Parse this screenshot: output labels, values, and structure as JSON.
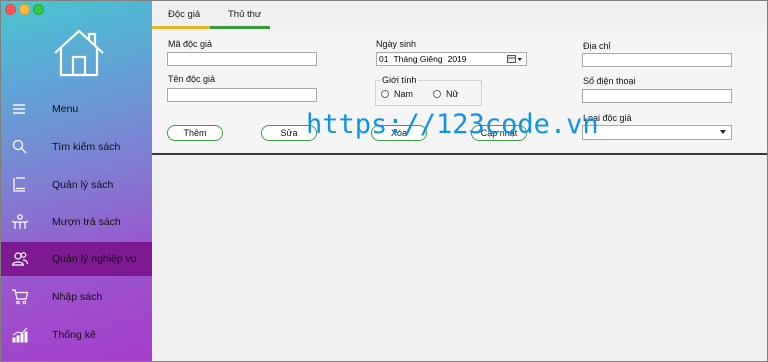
{
  "sidebar": {
    "home_icon": "home-icon",
    "items": [
      {
        "label": "Menu",
        "icon": "hamburger-icon"
      },
      {
        "label": "Tìm kiếm sách",
        "icon": "search-icon"
      },
      {
        "label": "Quản lý sách",
        "icon": "book-icon"
      },
      {
        "label": "Mượn trả sách",
        "icon": "borrow-icon"
      },
      {
        "label": "Quản lý nghiệp vu",
        "icon": "users-icon",
        "active": true
      },
      {
        "label": "Nhập sách",
        "icon": "cart-icon"
      },
      {
        "label": "Thống kê",
        "icon": "chart-icon"
      }
    ],
    "active_color": "#7d1a92"
  },
  "tabs": [
    {
      "label": "Độc giả",
      "underline_color": "#e0b824"
    },
    {
      "label": "Thủ thư",
      "underline_color": "#3a9a3a"
    }
  ],
  "form": {
    "ma_doc_gia": {
      "label": "Mã độc giả",
      "value": ""
    },
    "ten_doc_gia": {
      "label": "Tên độc giả",
      "value": ""
    },
    "ngay_sinh": {
      "label": "Ngày sinh",
      "day": "01",
      "month": "Tháng Giêng",
      "year": "2019"
    },
    "gioi_tinh": {
      "label": "Giới tính",
      "options": [
        "Nam",
        "Nữ"
      ]
    },
    "dia_chi": {
      "label": "Địa chỉ",
      "value": ""
    },
    "so_dien_thoai": {
      "label": "Số điện thoại",
      "value": ""
    },
    "loai_doc_gia": {
      "label": "Loại độc giả",
      "value": ""
    }
  },
  "buttons": {
    "them": "Thêm",
    "sua": "Sửa",
    "xoa": "Xóa",
    "cap_nhat": "Cập nhật"
  },
  "watermark": "https://123code.vn",
  "colors": {
    "button_border": "#3f9d4a",
    "watermark": "#0e93ea"
  }
}
